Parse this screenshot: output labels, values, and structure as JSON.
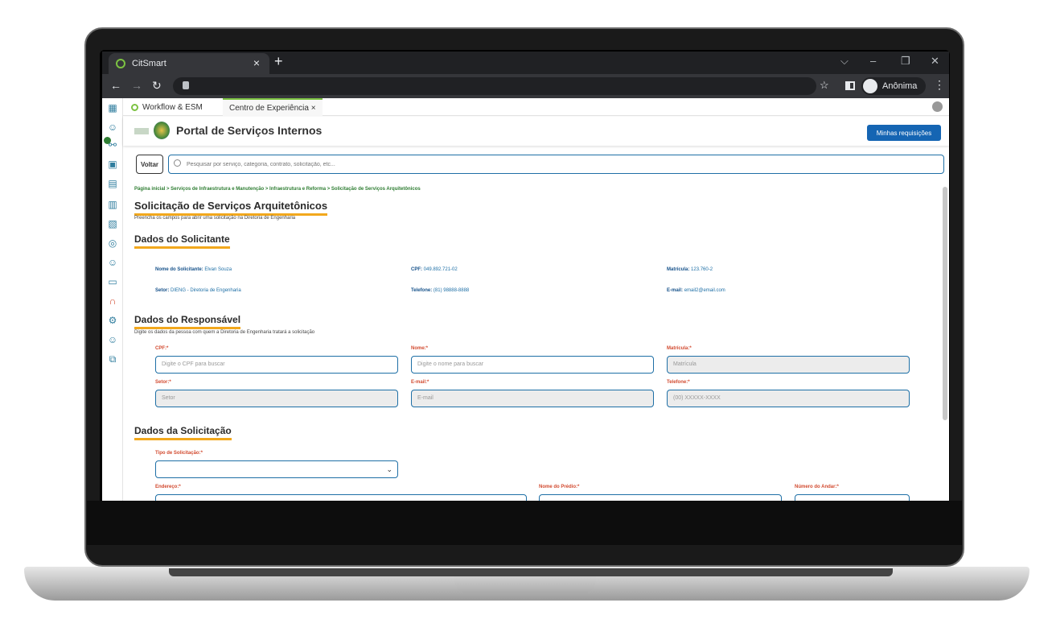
{
  "browser": {
    "tab_title": "CitSmart",
    "tab_close": "×",
    "new_tab": "+",
    "incognito_label": "Anônima",
    "min": "–",
    "restore": "❐",
    "close": "✕",
    "dropdown": "⌵"
  },
  "app_tabs": [
    {
      "label": "Workflow & ESM"
    },
    {
      "label": "Centro de Experiência  ×"
    }
  ],
  "header": {
    "title": "Portal de Serviços Internos",
    "my_requests": "Minhas requisições"
  },
  "search": {
    "back": "Voltar",
    "placeholder": "Pesquisar por serviço, categoria, contrato, solicitação, etc..."
  },
  "breadcrumb": "Página inicial > Serviços de Infraestrutura e Manutenção > Infraestrutura e Reforma > Solicitação de Serviços Arquitetônicos",
  "page": {
    "title": "Solicitação de Serviços Arquitetônicos",
    "subtitle": "Preencha os campos para abrir uma solicitação na Diretoria de Engenharia"
  },
  "solicitante": {
    "heading": "Dados do Solicitante",
    "nome_label": "Nome do Solicitante:",
    "nome_value": "Elvan Souza",
    "cpf_label": "CPF:",
    "cpf_value": "049.892.721-02",
    "matricula_label": "Matrícula:",
    "matricula_value": "123.760-2",
    "setor_label": "Setor:",
    "setor_value": "DIENG - Diretoria de Engenharia",
    "telefone_label": "Telefone:",
    "telefone_value": "(81) 98888-8888",
    "email_label": "E-mail:",
    "email_value": "email2@email.com"
  },
  "responsavel": {
    "heading": "Dados do Responsável",
    "subtitle": "Digite os dados da pessoa com quem a Diretoria de Engenharia tratará a solicitação",
    "cpf_label": "CPF:*",
    "cpf_placeholder": "Digite o CPF para buscar",
    "nome_label": "Nome:*",
    "nome_placeholder": "Digite o nome para buscar",
    "matricula_label": "Matrícula:*",
    "matricula_placeholder": "Matrícula",
    "setor_label": "Setor:*",
    "setor_placeholder": "Setor",
    "email_label": "E-mail:*",
    "email_placeholder": "E-mail",
    "telefone_label": "Telefone:*",
    "telefone_placeholder": "(00) XXXXX-XXXX"
  },
  "solicitacao": {
    "heading": "Dados da Solicitação",
    "tipo_label": "Tipo de Solicitação:*",
    "endereco_label": "Endereço:*",
    "predio_label": "Nome do Prédio:*",
    "andar_label": "Número do Andar:*"
  },
  "colors": {
    "accent": "#f2a81d",
    "primary": "#1565b3",
    "required_label": "#d24a2f",
    "field_border": "#1e6fa6"
  }
}
